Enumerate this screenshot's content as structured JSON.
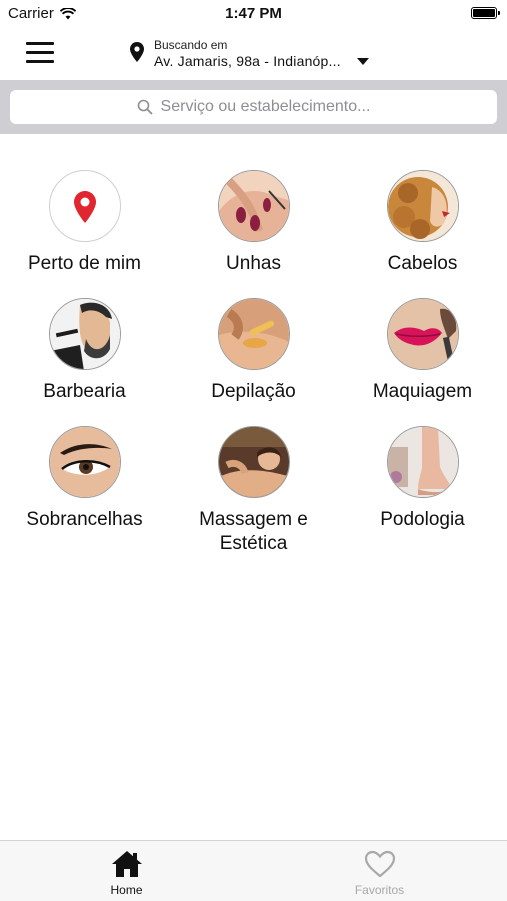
{
  "status_bar": {
    "carrier": "Carrier",
    "time": "1:47 PM"
  },
  "header": {
    "location_label": "Buscando em",
    "location_address": "Av. Jamaris, 98a - Indianóp..."
  },
  "search": {
    "placeholder": "Serviço ou estabelecimento..."
  },
  "categories": [
    {
      "label": "Perto de mim",
      "icon": "location-pin-icon"
    },
    {
      "label": "Unhas",
      "icon": "nails-photo"
    },
    {
      "label": "Cabelos",
      "icon": "hair-photo"
    },
    {
      "label": "Barbearia",
      "icon": "barber-photo"
    },
    {
      "label": "Depilação",
      "icon": "waxing-photo"
    },
    {
      "label": "Maquiagem",
      "icon": "makeup-photo"
    },
    {
      "label": "Sobrancelhas",
      "icon": "eyebrow-photo"
    },
    {
      "label": "Massagem e Estética",
      "icon": "massage-photo"
    },
    {
      "label": "Podologia",
      "icon": "foot-photo"
    }
  ],
  "tabs": [
    {
      "label": "Home",
      "icon": "home-icon",
      "active": true
    },
    {
      "label": "Favoritos",
      "icon": "heart-icon",
      "active": false
    }
  ],
  "colors": {
    "pin_red": "#e0262f",
    "search_bg": "#cfcfd3",
    "inactive_tab": "#a8a8a8"
  }
}
